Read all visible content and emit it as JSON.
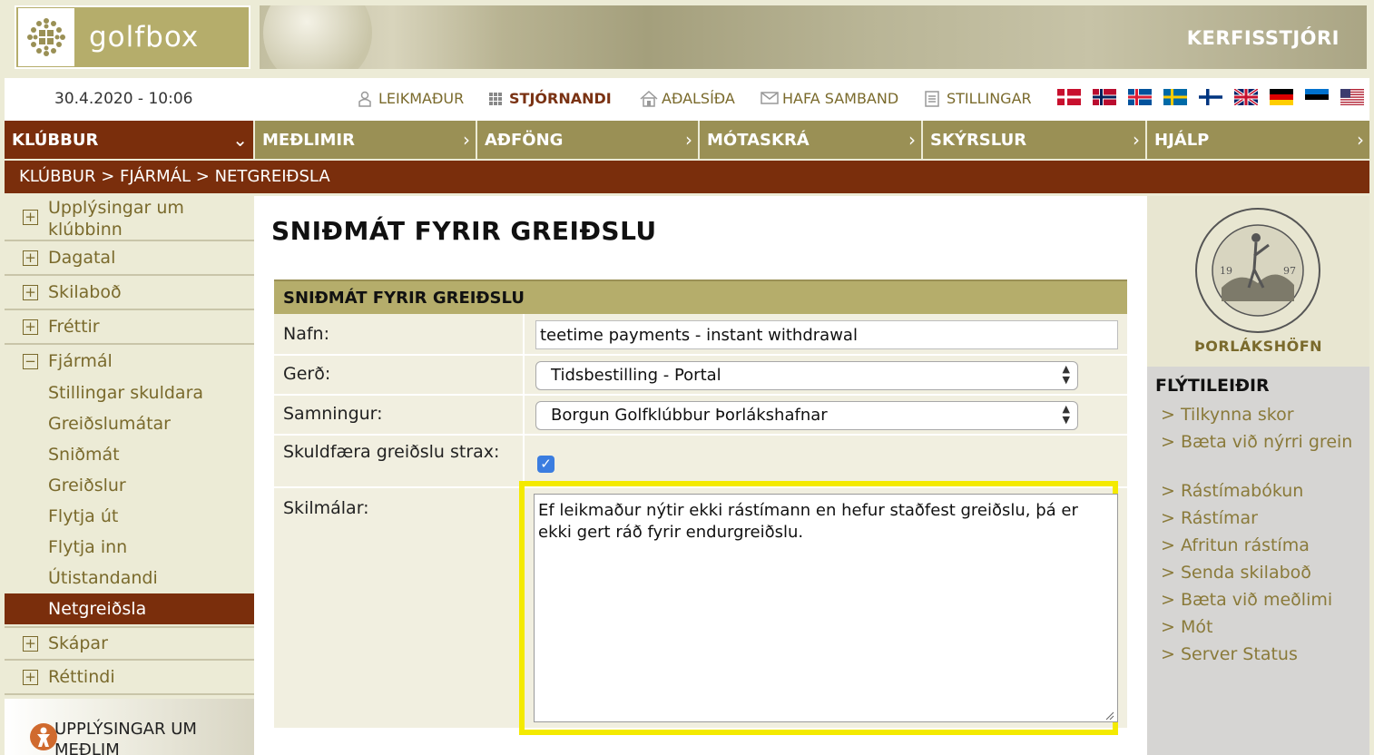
{
  "banner": {
    "logo_text": "golfbox",
    "title": "KERFISSTJÓRI"
  },
  "topbar": {
    "datetime": "30.4.2020 - 10:06",
    "links": [
      {
        "label": "LEIKMAÐUR",
        "icon": "person-icon"
      },
      {
        "label": "STJÓRNANDI",
        "icon": "grid-icon"
      },
      {
        "label": "AÐALSÍÐA",
        "icon": "home-icon"
      },
      {
        "label": "HAFA SAMBAND",
        "icon": "mail-icon"
      },
      {
        "label": "STILLINGAR",
        "icon": "settings-doc-icon"
      }
    ],
    "flags": [
      "denmark",
      "norway",
      "iceland",
      "sweden",
      "finland",
      "united-kingdom",
      "germany",
      "estonia",
      "united-states"
    ]
  },
  "nav": {
    "items": [
      {
        "label": "KLÚBBUR",
        "chevron": "⌄"
      },
      {
        "label": "MEÐLIMIR",
        "chevron": "›"
      },
      {
        "label": "AÐFÖNG",
        "chevron": "›"
      },
      {
        "label": "MÓTASKRÁ",
        "chevron": "›"
      },
      {
        "label": "SKÝRSLUR",
        "chevron": "›"
      },
      {
        "label": "HJÁLP",
        "chevron": "›"
      }
    ]
  },
  "breadcrumb": "KLÚBBUR > FJÁRMÁL > NETGREIÐSLA",
  "sidebar": {
    "items": [
      {
        "label": "Upplýsingar um klúbbinn",
        "box": "+"
      },
      {
        "label": "Dagatal",
        "box": "+"
      },
      {
        "label": "Skilaboð",
        "box": "+"
      },
      {
        "label": "Fréttir",
        "box": "+"
      },
      {
        "label": "Fjármál",
        "box": "−"
      }
    ],
    "subitems": [
      "Stillingar skuldara",
      "Greiðslumátar",
      "Sniðmát",
      "Greiðslur",
      "Flytja út",
      "Flytja inn",
      "Útistandandi",
      "Netgreiðsla"
    ],
    "items_after": [
      {
        "label": "Skápar",
        "box": "+"
      },
      {
        "label": "Réttindi",
        "box": "+"
      }
    ],
    "member_box": "UPPLÝSINGAR UM MEÐLIM"
  },
  "main": {
    "title": "SNIÐMÁT FYRIR GREIÐSLU",
    "form": {
      "header": "SNIÐMÁT FYRIR GREIÐSLU",
      "name_label": "Nafn:",
      "name_value": "teetime payments - instant withdrawal",
      "type_label": "Gerð:",
      "type_value": "Tidsbestilling - Portal",
      "contract_label": "Samningur:",
      "contract_value": "Borgun Golfklúbbur Þorlákshafnar",
      "charge_label": "Skuldfæra greiðslu strax:",
      "charge_checked": true,
      "terms_label": "Skilmálar:",
      "terms_value": "Ef leikmaður nýtir ekki rástímann en hefur staðfest greiðslu, þá er ekki gert ráð fyrir endurgreiðslu."
    }
  },
  "right": {
    "club_name": "ÞORLÁKSHÖFN",
    "quick_title": "FLÝTILEIÐIR",
    "quick_links": [
      "> Tilkynna skor",
      "> Bæta við nýrri grein",
      "> Rástímabókun",
      "> Rástímar",
      "> Afritun rástíma",
      "> Senda skilaboð",
      "> Bæta við meðlimi",
      "> Mót",
      "> Server Status"
    ]
  },
  "colors": {
    "brown": "#7a2e0c",
    "olive": "#9a9055",
    "gold": "#b5ad6b",
    "highlight": "#f4ea00"
  }
}
